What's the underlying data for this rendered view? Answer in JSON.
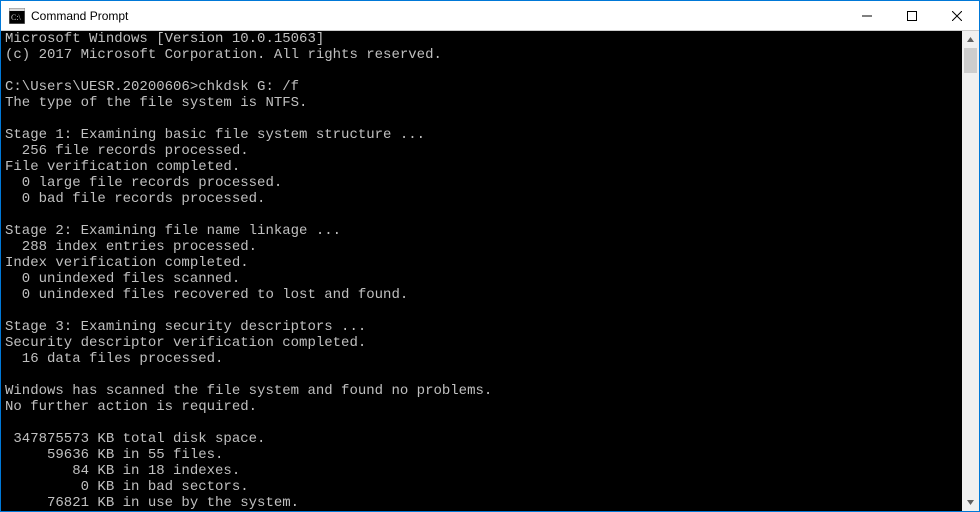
{
  "titlebar": {
    "title": "Command Prompt"
  },
  "console": {
    "lines": [
      "Microsoft Windows [Version 10.0.15063]",
      "(c) 2017 Microsoft Corporation. All rights reserved.",
      "",
      "C:\\Users\\UESR.20200606>chkdsk G: /f",
      "The type of the file system is NTFS.",
      "",
      "Stage 1: Examining basic file system structure ...",
      "  256 file records processed.",
      "File verification completed.",
      "  0 large file records processed.",
      "  0 bad file records processed.",
      "",
      "Stage 2: Examining file name linkage ...",
      "  288 index entries processed.",
      "Index verification completed.",
      "  0 unindexed files scanned.",
      "  0 unindexed files recovered to lost and found.",
      "",
      "Stage 3: Examining security descriptors ...",
      "Security descriptor verification completed.",
      "  16 data files processed.",
      "",
      "Windows has scanned the file system and found no problems.",
      "No further action is required.",
      "",
      " 347875573 KB total disk space.",
      "     59636 KB in 55 files.",
      "        84 KB in 18 indexes.",
      "         0 KB in bad sectors.",
      "     76821 KB in use by the system."
    ]
  }
}
